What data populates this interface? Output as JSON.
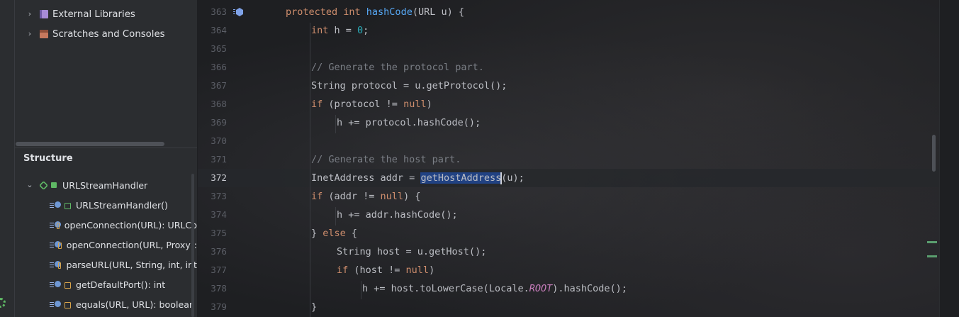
{
  "project_tree": {
    "items": [
      {
        "label": "External Libraries",
        "icon": "library-icon"
      },
      {
        "label": "Scratches and Consoles",
        "icon": "scratches-icon"
      }
    ]
  },
  "structure": {
    "title": "Structure",
    "root": {
      "label": "URLStreamHandler",
      "icon": "class-icon"
    },
    "members": [
      {
        "label": "URLStreamHandler()",
        "access": "public"
      },
      {
        "label": "openConnection(URL): URLCo",
        "access": "protected"
      },
      {
        "label": "openConnection(URL, Proxy):",
        "access": "protected"
      },
      {
        "label": "parseURL(URL, String, int, int",
        "access": "protected"
      },
      {
        "label": "getDefaultPort(): int",
        "access": "protected"
      },
      {
        "label": "equals(URL, URL): boolean",
        "access": "protected"
      }
    ]
  },
  "editor": {
    "current_line": 372,
    "lines": [
      {
        "n": "363",
        "tokens": [
          [
            "kw",
            "protected "
          ],
          [
            "kw",
            "int "
          ],
          [
            "fn",
            "hashCode"
          ],
          [
            "p",
            "(URL u) {"
          ]
        ],
        "indent": 0
      },
      {
        "n": "364",
        "tokens": [
          [
            "kw",
            "int "
          ],
          [
            "p",
            "h = "
          ],
          [
            "num",
            "0"
          ],
          [
            "p",
            ";"
          ]
        ],
        "indent": 1
      },
      {
        "n": "365",
        "tokens": [],
        "indent": 1
      },
      {
        "n": "366",
        "tokens": [
          [
            "cm",
            "// Generate the protocol part."
          ]
        ],
        "indent": 1
      },
      {
        "n": "367",
        "tokens": [
          [
            "p",
            "String protocol = u.getProtocol();"
          ]
        ],
        "indent": 1
      },
      {
        "n": "368",
        "tokens": [
          [
            "kw",
            "if "
          ],
          [
            "p",
            "(protocol != "
          ],
          [
            "kw",
            "null"
          ],
          [
            "p",
            ")"
          ]
        ],
        "indent": 1
      },
      {
        "n": "369",
        "tokens": [
          [
            "p",
            "h += protocol.hashCode();"
          ]
        ],
        "indent": 2
      },
      {
        "n": "370",
        "tokens": [],
        "indent": 1
      },
      {
        "n": "371",
        "tokens": [
          [
            "cm",
            "// Generate the host part."
          ]
        ],
        "indent": 1
      },
      {
        "n": "372",
        "tokens": [
          [
            "p",
            "InetAddress addr = "
          ],
          [
            "sel",
            "getHostAddress"
          ],
          [
            "caret",
            ""
          ],
          [
            "p",
            "(u);"
          ]
        ],
        "indent": 1
      },
      {
        "n": "373",
        "tokens": [
          [
            "kw",
            "if "
          ],
          [
            "p",
            "(addr != "
          ],
          [
            "kw",
            "null"
          ],
          [
            "p",
            ") {"
          ]
        ],
        "indent": 1
      },
      {
        "n": "374",
        "tokens": [
          [
            "p",
            "h += addr.hashCode();"
          ]
        ],
        "indent": 2
      },
      {
        "n": "375",
        "tokens": [
          [
            "p",
            "} "
          ],
          [
            "kw",
            "else "
          ],
          [
            "p",
            "{"
          ]
        ],
        "indent": 1
      },
      {
        "n": "376",
        "tokens": [
          [
            "p",
            "String host = u.getHost();"
          ]
        ],
        "indent": 2
      },
      {
        "n": "377",
        "tokens": [
          [
            "kw",
            "if "
          ],
          [
            "p",
            "(host != "
          ],
          [
            "kw",
            "null"
          ],
          [
            "p",
            ")"
          ]
        ],
        "indent": 2
      },
      {
        "n": "378",
        "tokens": [
          [
            "p",
            "h += host.toLowerCase(Locale."
          ],
          [
            "st",
            "ROOT"
          ],
          [
            "p",
            ").hashCode();"
          ]
        ],
        "indent": 3
      },
      {
        "n": "379",
        "tokens": [
          [
            "p",
            "}"
          ]
        ],
        "indent": 1
      }
    ]
  },
  "colors": {
    "keyword": "#cf8e6d",
    "function": "#56a8f5",
    "number": "#2aacb8",
    "comment": "#7a7e85",
    "static_field": "#c77dbb",
    "selection": "#214283"
  }
}
